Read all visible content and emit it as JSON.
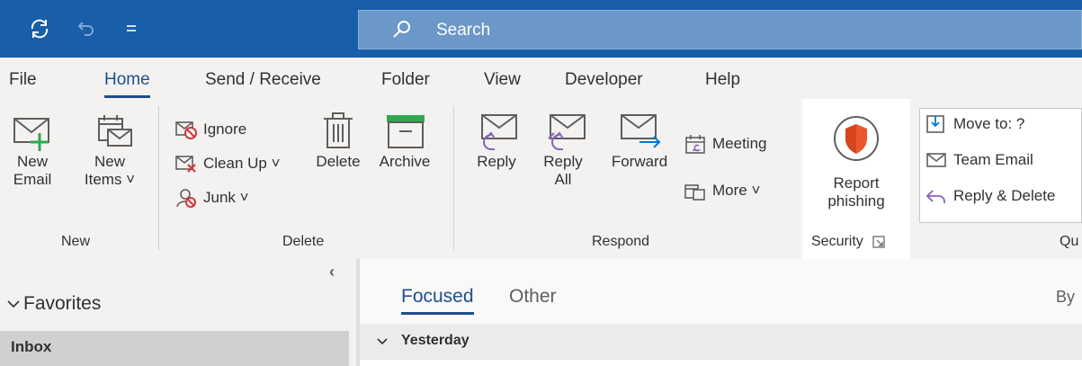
{
  "title_bar": {
    "search_placeholder": "Search",
    "qat": [
      "sync-icon",
      "undo-icon",
      "customize-qat-icon"
    ]
  },
  "tabs": [
    {
      "label": "File",
      "active": false
    },
    {
      "label": "Home",
      "active": true
    },
    {
      "label": "Send / Receive",
      "active": false
    },
    {
      "label": "Folder",
      "active": false
    },
    {
      "label": "View",
      "active": false
    },
    {
      "label": "Developer",
      "active": false
    },
    {
      "label": "Help",
      "active": false
    }
  ],
  "ribbon": {
    "new": {
      "group_label": "New",
      "new_email": "New\nEmail",
      "new_items": "New\nItems ˅"
    },
    "delete": {
      "group_label": "Delete",
      "ignore": "Ignore",
      "clean_up": "Clean Up ˅",
      "junk": "Junk ˅",
      "delete": "Delete",
      "archive": "Archive"
    },
    "respond": {
      "group_label": "Respond",
      "reply": "Reply",
      "reply_all": "Reply\nAll",
      "forward": "Forward",
      "meeting": "Meeting",
      "more": "More ˅"
    },
    "security": {
      "group_label": "Security",
      "report_phishing": "Report\nphishing"
    },
    "quick_steps": {
      "group_label": "Qu",
      "move_to": "Move to: ?",
      "team_email": "Team Email",
      "reply_delete": "Reply & Delete"
    }
  },
  "navigation": {
    "favorites": "Favorites",
    "inbox": "Inbox"
  },
  "message_list": {
    "focused": "Focused",
    "other": "Other",
    "by": "By",
    "group": "Yesterday"
  },
  "colors": {
    "title_bar": "#195ea8",
    "accent": "#1e4e8c",
    "phishing_shield": "#e8582c"
  }
}
